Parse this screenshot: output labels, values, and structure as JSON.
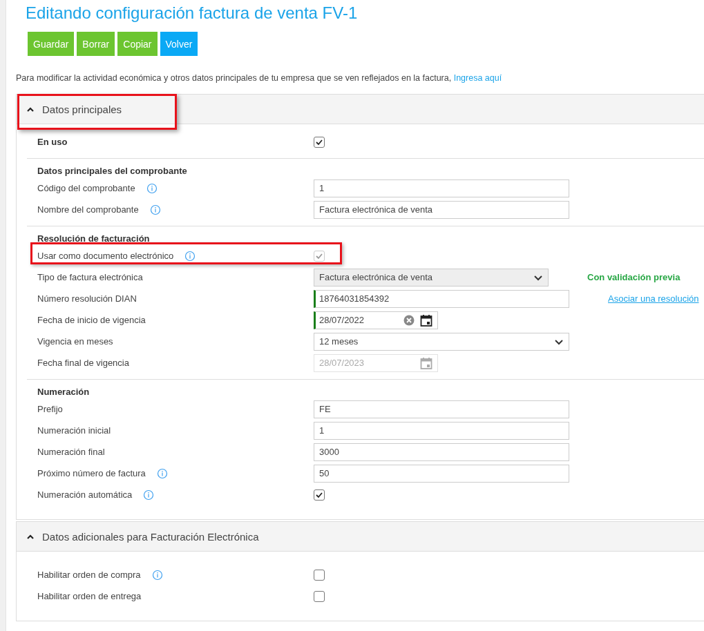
{
  "page": {
    "title": "Editando configuración factura de venta FV-1"
  },
  "actions": [
    {
      "label": "Guardar",
      "kind": "primary"
    },
    {
      "label": "Borrar",
      "kind": "primary"
    },
    {
      "label": "Copiar",
      "kind": "primary"
    },
    {
      "label": "Volver",
      "kind": "secondary"
    }
  ],
  "notice": {
    "text": "Para modificar la actividad económica y otros datos principales de tu empresa que se ven reflejados en la factura,",
    "link": "Ingresa aquí"
  },
  "sections": [
    {
      "title": "Datos principales",
      "expanded": true,
      "highlighted": true,
      "groups": [
        {
          "rows": [
            {
              "kind": "checkbox",
              "label": "En uso",
              "emphasis": true,
              "checked": true,
              "disabled": false
            }
          ]
        },
        {
          "heading": "Datos principales del comprobante",
          "rows": [
            {
              "kind": "text",
              "label": "Código del comprobante",
              "info": true,
              "value": "1",
              "validated": false,
              "disabled": false
            },
            {
              "kind": "text",
              "label": "Nombre del comprobante",
              "info": true,
              "value": "Factura electrónica de venta",
              "validated": false,
              "disabled": false
            }
          ]
        },
        {
          "heading": "Resolución de facturación",
          "rows": [
            {
              "kind": "checkbox",
              "label": "Usar como documento electrónico",
              "info": true,
              "checked": true,
              "disabled": true,
              "highlighted": true
            },
            {
              "kind": "select",
              "label": "Tipo de factura electrónica",
              "info": false,
              "value": "Factura electrónica de venta",
              "disabled": true,
              "aside": {
                "kind": "note",
                "text": "Con validación previa"
              }
            },
            {
              "kind": "text",
              "label": "Número resolución DIAN",
              "info": false,
              "value": "18764031854392",
              "validated": true,
              "disabled": false,
              "aside": {
                "kind": "link",
                "text": "Asociar una resolución"
              }
            },
            {
              "kind": "date",
              "label": "Fecha de inicio de vigencia",
              "info": false,
              "value": "28/07/2022",
              "validated": true,
              "disabled": false
            },
            {
              "kind": "select",
              "label": "Vigencia en meses",
              "info": false,
              "value": "12 meses",
              "disabled": false
            },
            {
              "kind": "date",
              "label": "Fecha final de vigencia",
              "info": false,
              "value": "28/07/2023",
              "validated": false,
              "disabled": true
            }
          ]
        },
        {
          "heading": "Numeración",
          "rows": [
            {
              "kind": "text",
              "label": "Prefijo",
              "info": false,
              "value": "FE",
              "validated": false,
              "disabled": false
            },
            {
              "kind": "text",
              "label": "Numeración inicial",
              "info": false,
              "value": "1",
              "validated": false,
              "disabled": false
            },
            {
              "kind": "text",
              "label": "Numeración final",
              "info": false,
              "value": "3000",
              "validated": false,
              "disabled": false
            },
            {
              "kind": "text",
              "label": "Próximo número de factura",
              "info": true,
              "value": "50",
              "validated": false,
              "disabled": false
            },
            {
              "kind": "checkbox",
              "label": "Numeración automática",
              "info": true,
              "checked": true,
              "disabled": false
            }
          ]
        }
      ]
    },
    {
      "title": "Datos adicionales para Facturación Electrónica",
      "expanded": true,
      "groups": [
        {
          "rows": [
            {
              "kind": "checkbox",
              "label": "Habilitar orden de compra",
              "info": true,
              "checked": false,
              "disabled": false
            },
            {
              "kind": "checkbox",
              "label": "Habilitar orden de entrega",
              "info": false,
              "checked": false,
              "disabled": false
            }
          ]
        }
      ]
    }
  ]
}
